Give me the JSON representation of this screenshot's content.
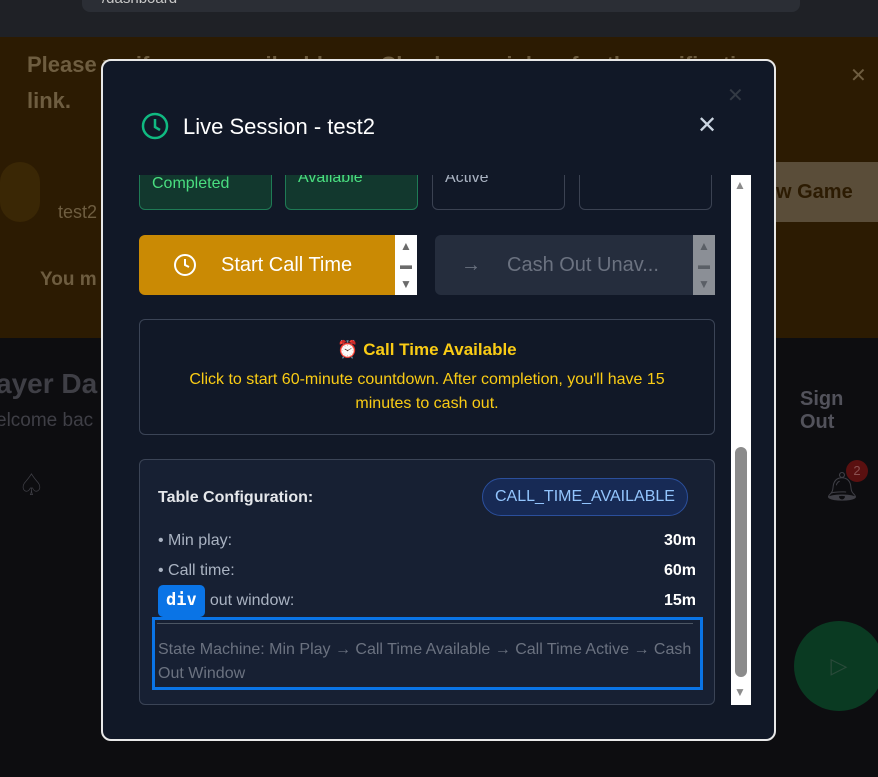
{
  "browser": {
    "url": "/dashboard"
  },
  "background": {
    "banner_text": "Please verify your email address. Check your inbox for the verification link.",
    "game_user": "test2",
    "new_game_label": "w Game",
    "warning_text": "You m",
    "page_title": "ayer Da",
    "welcome": "elcome bac",
    "sign_out": "Sign Out",
    "notification_count": "2"
  },
  "modal": {
    "title": "Live Session - test2",
    "status_cards": [
      {
        "label": "Completed",
        "state": "done"
      },
      {
        "label": "Available",
        "state": "done"
      },
      {
        "label": "Active",
        "state": "pending"
      },
      {
        "label": "",
        "state": "pending"
      }
    ],
    "start_call_time_label": "Start Call Time",
    "cash_out_label": "Cash Out Unav...",
    "info": {
      "title": "Call Time Available",
      "icon": "alarm-clock",
      "text": "Click to start 60-minute countdown. After completion, you'll have 15 minutes to cash out."
    },
    "config": {
      "heading": "Table Configuration:",
      "state_badge": "CALL_TIME_AVAILABLE",
      "rows": [
        {
          "label": "• Min play:",
          "value": "30m"
        },
        {
          "label": "• Call time:",
          "value": "60m"
        },
        {
          "label": "• Cash out window:",
          "value": "15m"
        }
      ],
      "state_machine": "State Machine: Min Play → Call Time Available → Call Time Active → Cash Out Window"
    },
    "inspector_tag": "div"
  },
  "colors": {
    "accent_green": "#10b981",
    "button_gold": "#ca8a04",
    "info_yellow": "#facc15",
    "badge_blue": "#93c5fd",
    "highlight": "#0a74e6"
  }
}
